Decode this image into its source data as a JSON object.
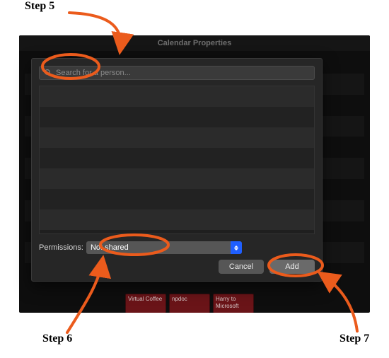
{
  "window": {
    "title": "Calendar Properties"
  },
  "search": {
    "placeholder": "Search for a person..."
  },
  "permissions": {
    "label": "Permissions:",
    "value": "Not shared"
  },
  "buttons": {
    "cancel": "Cancel",
    "add": "Add"
  },
  "peek": {
    "tile1": "Virtual Coffee",
    "tile2": "npdoc",
    "tile3": "Harry to Microsoft"
  },
  "annotations": {
    "step5": "Step 5",
    "step6": "Step 6",
    "step7": "Step 7",
    "color": "#eb5b1c"
  }
}
